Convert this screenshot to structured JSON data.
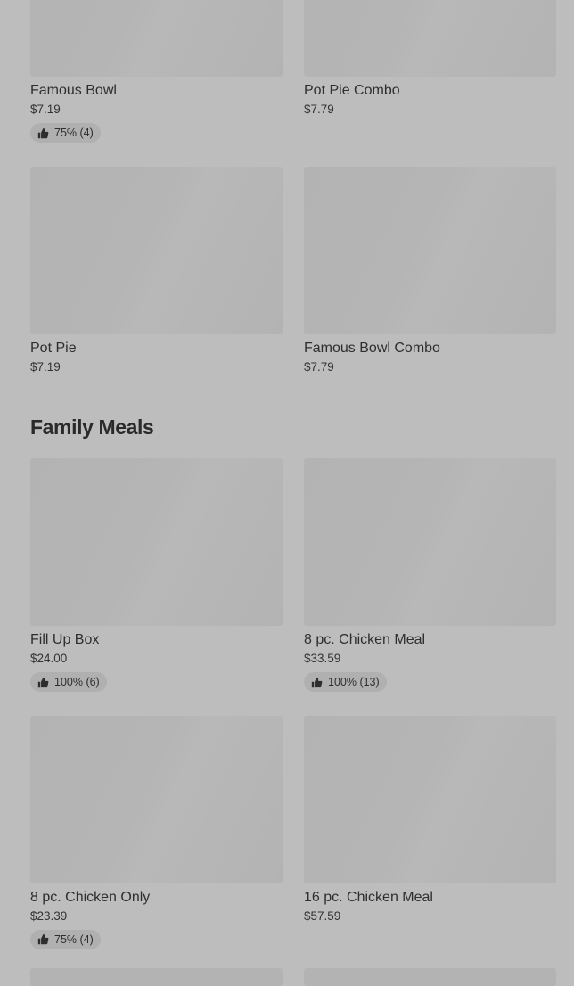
{
  "top_items": [
    {
      "name": "Famous Bowl",
      "price": "$7.19",
      "rating": "75% (4)"
    },
    {
      "name": "Pot Pie Combo",
      "price": "$7.79",
      "rating": null
    },
    {
      "name": "Pot Pie",
      "price": "$7.19",
      "rating": null
    },
    {
      "name": "Famous Bowl Combo",
      "price": "$7.79",
      "rating": null
    }
  ],
  "family_section": {
    "title": "Family Meals",
    "items": [
      {
        "name": "Fill Up Box",
        "price": "$24.00",
        "rating": "100% (6)"
      },
      {
        "name": "8 pc. Chicken Meal",
        "price": "$33.59",
        "rating": "100% (13)"
      },
      {
        "name": "8 pc. Chicken Only",
        "price": "$23.39",
        "rating": "75% (4)"
      },
      {
        "name": "16 pc. Chicken Meal",
        "price": "$57.59",
        "rating": null
      }
    ]
  },
  "icons": {
    "rating_icon": "thumbs-up-icon"
  },
  "colors": {
    "background": "#bdbdbd",
    "placeholder": "#b3b3b3",
    "badge": "#b0b0b0"
  }
}
